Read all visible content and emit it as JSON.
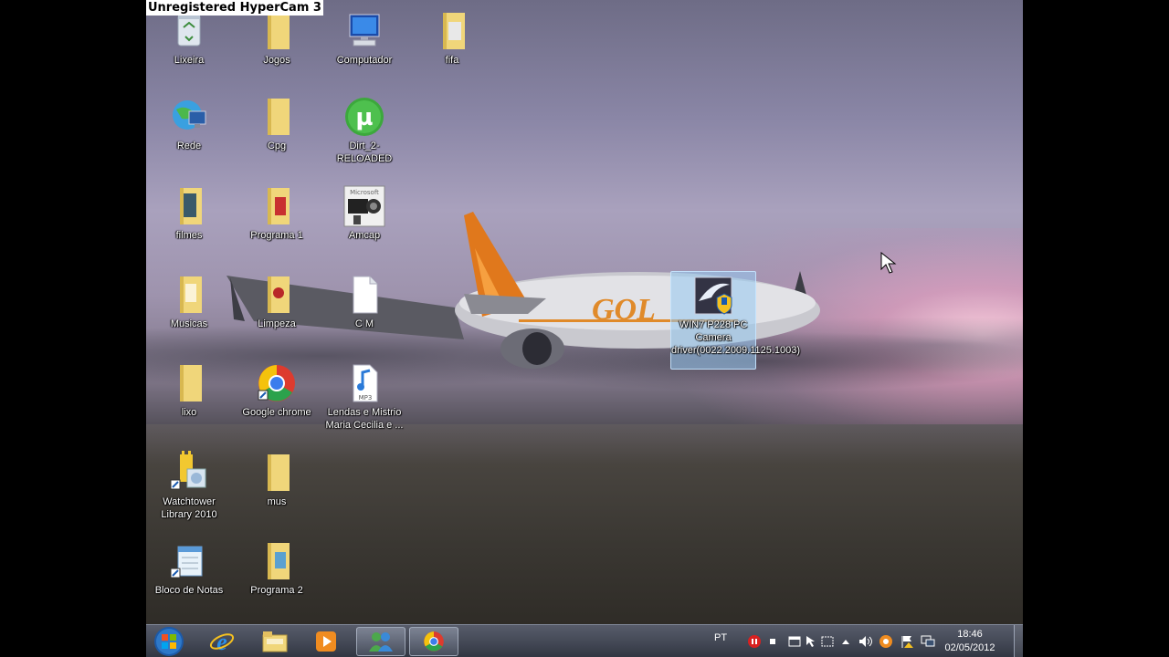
{
  "recorder_watermark": "Unregistered HyperCam 3",
  "desktop_icons": [
    {
      "label": "Lixeira"
    },
    {
      "label": "Jogos"
    },
    {
      "label": "Computador"
    },
    {
      "label": "fifa"
    },
    {
      "label": "Rede"
    },
    {
      "label": "Cpg"
    },
    {
      "label": "Dirt_2-RELOADED"
    },
    {
      "label": "filmes"
    },
    {
      "label": "Programa 1"
    },
    {
      "label": "Amcap"
    },
    {
      "label": "Musicas"
    },
    {
      "label": "Limpeza"
    },
    {
      "label": "C M"
    },
    {
      "label": "WIN7 P228 PC Camera driver(0022.2009.1125.1003)"
    },
    {
      "label": "lixo"
    },
    {
      "label": "Google chrome"
    },
    {
      "label": "Lendas e Mistrio Maria Cecilia e ..."
    },
    {
      "label": "Watchtower Library 2010"
    },
    {
      "label": "mus"
    },
    {
      "label": "Bloco de Notas"
    },
    {
      "label": "Programa 2"
    }
  ],
  "taskbar": {
    "language": "PT",
    "time": "18:46",
    "date": "02/05/2012",
    "pinned": [
      "internet-explorer",
      "windows-explorer",
      "media-player",
      "messenger",
      "google-chrome"
    ]
  },
  "colors": {
    "folder": "#e8c860",
    "selection": "#9cc8ee"
  }
}
